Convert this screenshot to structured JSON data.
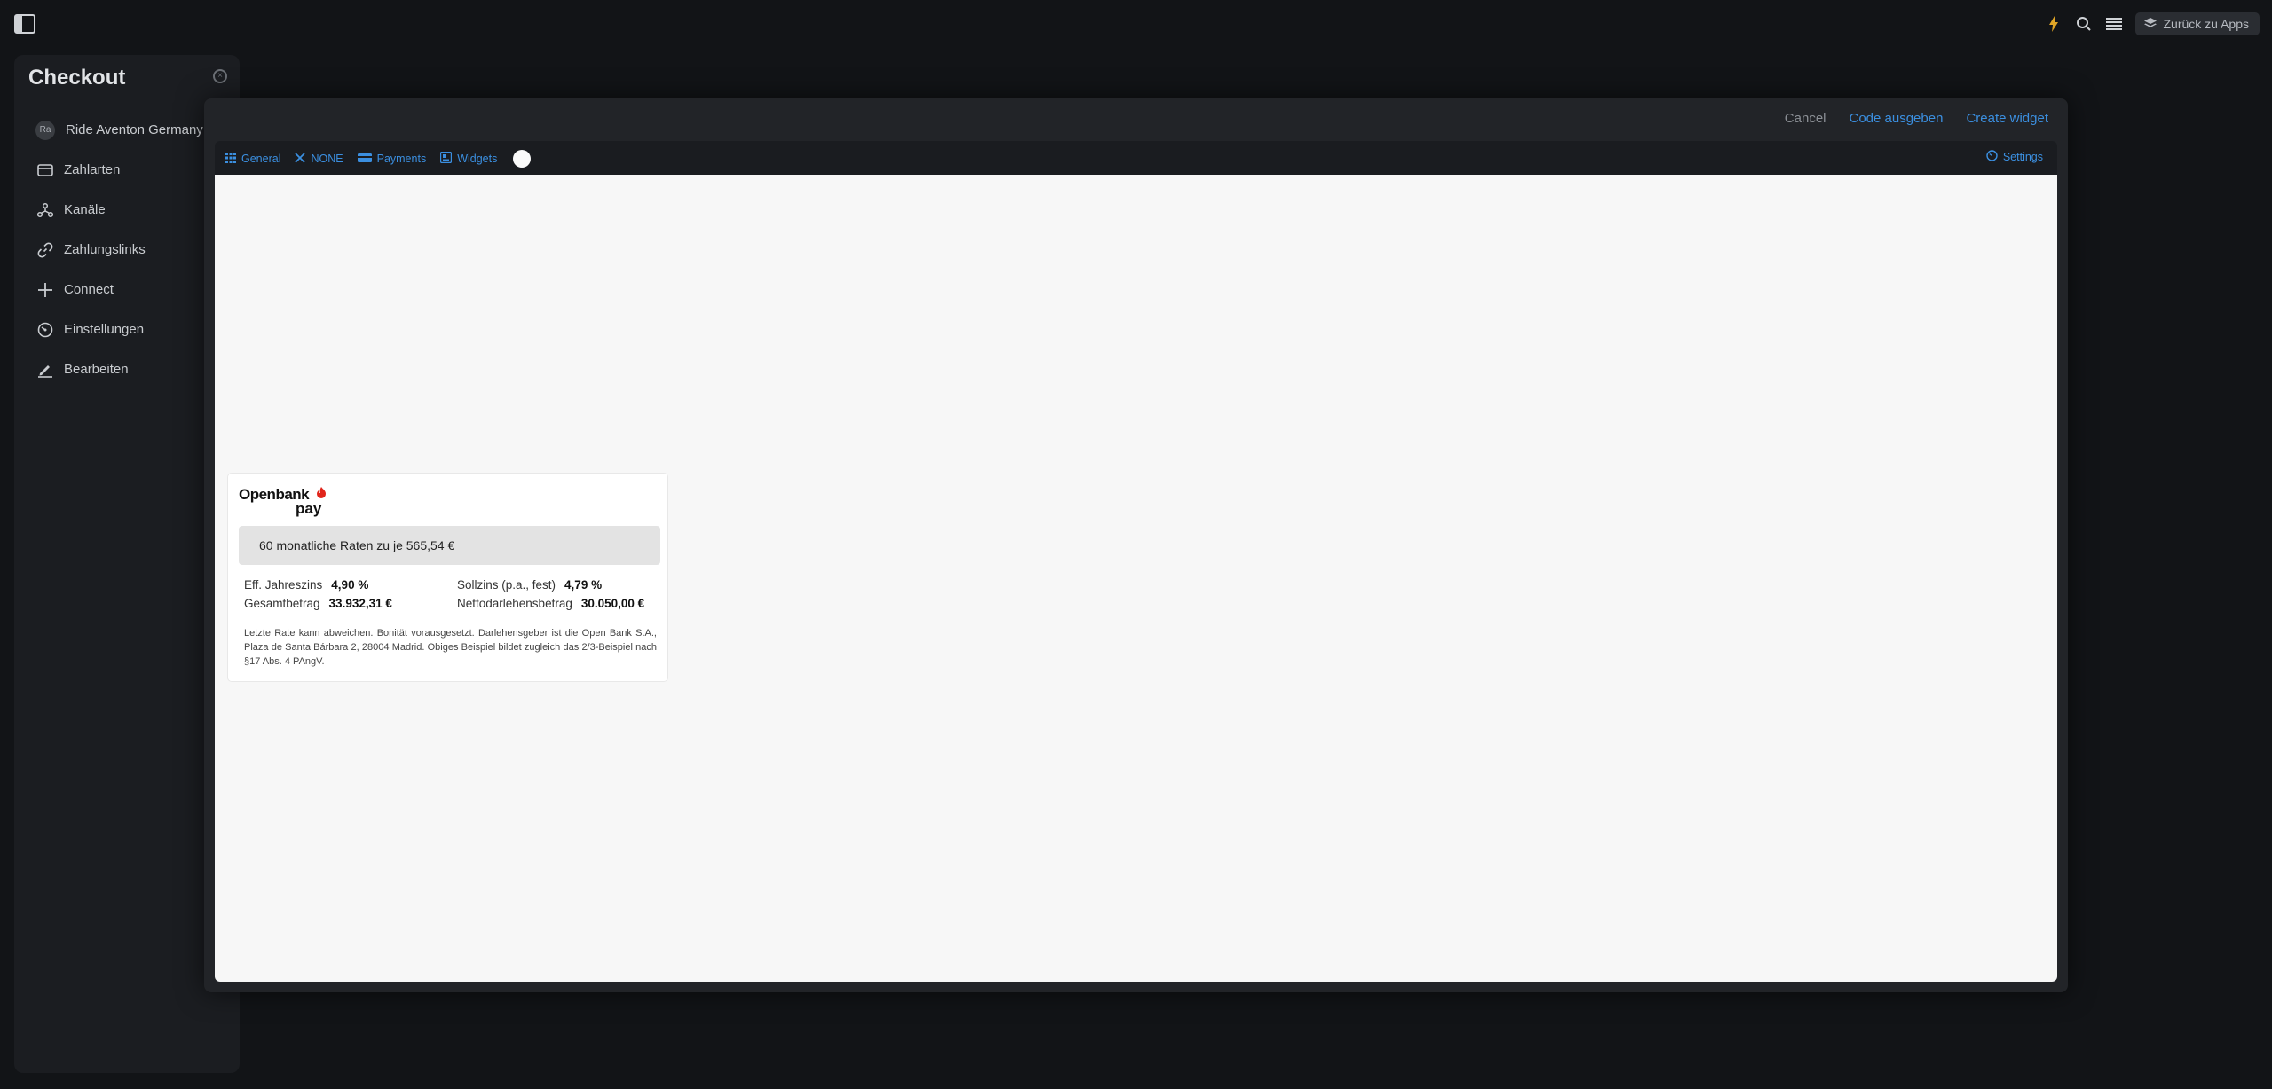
{
  "topbar": {
    "back_label": "Zurück zu Apps"
  },
  "panel": {
    "title": "Checkout",
    "items": [
      {
        "label": "Ride Aventon Germany G",
        "avatar": "Ra"
      },
      {
        "label": "Zahlarten"
      },
      {
        "label": "Kanäle"
      },
      {
        "label": "Zahlungslinks"
      },
      {
        "label": "Connect"
      },
      {
        "label": "Einstellungen"
      },
      {
        "label": "Bearbeiten"
      }
    ]
  },
  "modal": {
    "cancel_label": "Cancel",
    "code_label": "Code ausgeben",
    "create_label": "Create widget",
    "toolbar": {
      "general": "General",
      "none": "NONE",
      "payments": "Payments",
      "widgets": "Widgets",
      "settings": "Settings"
    }
  },
  "widget": {
    "logo_top": "Openbank",
    "logo_bottom": "pay",
    "rate_text": "60 monatliche Raten zu je 565,54 €",
    "eff_label": "Eff. Jahreszins",
    "eff_value": "4,90 %",
    "soll_label": "Sollzins (p.a., fest)",
    "soll_value": "4,79 %",
    "gesamt_label": "Gesamtbetrag",
    "gesamt_value": "33.932,31 €",
    "netto_label": "Nettodarlehensbetrag",
    "netto_value": "30.050,00 €",
    "legal": "Letzte Rate kann abweichen. Bonität vorausgesetzt. Darlehensgeber ist die Open Bank S.A., Plaza de Santa Bárbara 2, 28004 Madrid. Obiges Beispiel bildet zugleich das 2/3-Beispiel nach §17 Abs. 4 PAngV."
  },
  "colors": {
    "accent": "#3b8fe0",
    "openbank_red": "#e1251b"
  }
}
